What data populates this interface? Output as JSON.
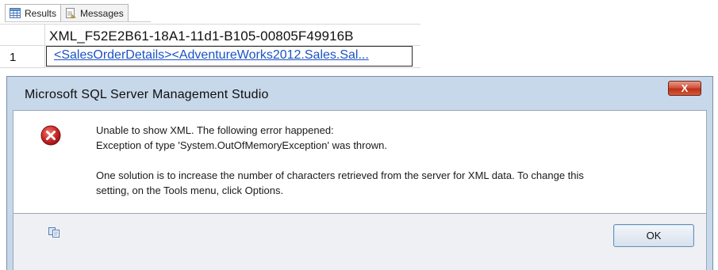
{
  "tabs": [
    {
      "label": "Results",
      "icon": "grid-icon",
      "active": true
    },
    {
      "label": "Messages",
      "icon": "messages-icon",
      "active": false
    }
  ],
  "grid": {
    "column_header": "XML_F52E2B61-18A1-11d1-B105-00805F49916B",
    "rows": [
      {
        "row_number": "1",
        "value": "<SalesOrderDetails><AdventureWorks2012.Sales.Sal..."
      }
    ]
  },
  "dialog": {
    "title": "Microsoft SQL Server Management Studio",
    "close_label": "X",
    "icon": "error-icon",
    "message_line1": "Unable to show XML. The following error happened:",
    "message_line2": "Exception of type 'System.OutOfMemoryException' was thrown.",
    "message_line3": "One solution is to increase the number of characters retrieved from the server for XML data. To change this",
    "message_line4": "setting, on the Tools menu, click Options.",
    "footer_icon": "copy-icon",
    "ok_label": "OK"
  },
  "colors": {
    "dialog_frame": "#c7d8ea",
    "close_button": "#c7422a",
    "link": "#1b52c5",
    "error_icon": "#c8282a"
  }
}
